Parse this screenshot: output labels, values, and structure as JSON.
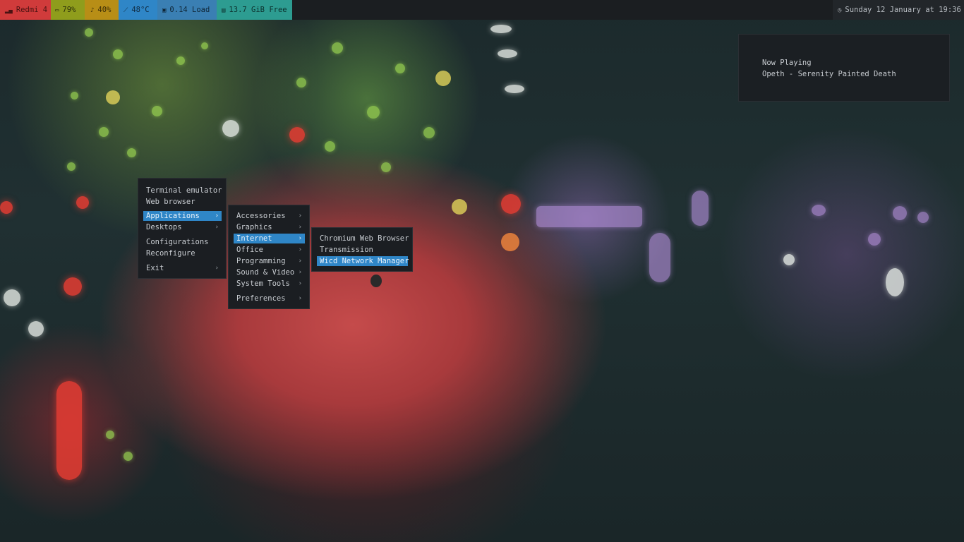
{
  "statusbar": {
    "phone": "Redmi 4",
    "battery": "79%",
    "volume": "40%",
    "temperature": "48°C",
    "load": "0.14 Load",
    "memory": "13.7 GiB Free",
    "clock": "Sunday 12 January at 19:36",
    "icons": {
      "phone": "signal-icon",
      "battery": "battery-icon",
      "volume": "bell-icon",
      "temperature": "thermometer-icon",
      "load": "cpu-icon",
      "memory": "disk-icon",
      "clock": "clock-icon"
    },
    "colors": {
      "phone": "#d03b3b",
      "battery": "#8f9d1c",
      "volume": "#b88e16",
      "temperature": "#2f86c7",
      "load": "#3a7fb3",
      "memory": "#2d9c91"
    }
  },
  "now_playing": {
    "title": "Now Playing",
    "track": "Opeth - Serenity Painted Death"
  },
  "root_menu": {
    "items": [
      {
        "label": "Terminal emulator"
      },
      {
        "label": "Web browser"
      },
      {
        "label": "Applications",
        "submenu": true,
        "selected": true
      },
      {
        "label": "Desktops",
        "submenu": true
      },
      {
        "label": "Configurations"
      },
      {
        "label": "Reconfigure"
      },
      {
        "label": "Exit",
        "submenu": true
      }
    ]
  },
  "applications_menu": {
    "items": [
      {
        "label": "Accessories",
        "submenu": true
      },
      {
        "label": "Graphics",
        "submenu": true
      },
      {
        "label": "Internet",
        "submenu": true,
        "selected": true
      },
      {
        "label": "Office",
        "submenu": true
      },
      {
        "label": "Programming",
        "submenu": true
      },
      {
        "label": "Sound & Video",
        "submenu": true
      },
      {
        "label": "System Tools",
        "submenu": true
      },
      {
        "label": "Preferences",
        "submenu": true
      }
    ]
  },
  "internet_menu": {
    "items": [
      {
        "label": "Chromium Web Browser"
      },
      {
        "label": "Transmission"
      },
      {
        "label": "Wicd Network Manager",
        "selected": true
      }
    ]
  },
  "theme": {
    "accent": "#2f86c7",
    "menu_bg": "#1b1e22"
  }
}
